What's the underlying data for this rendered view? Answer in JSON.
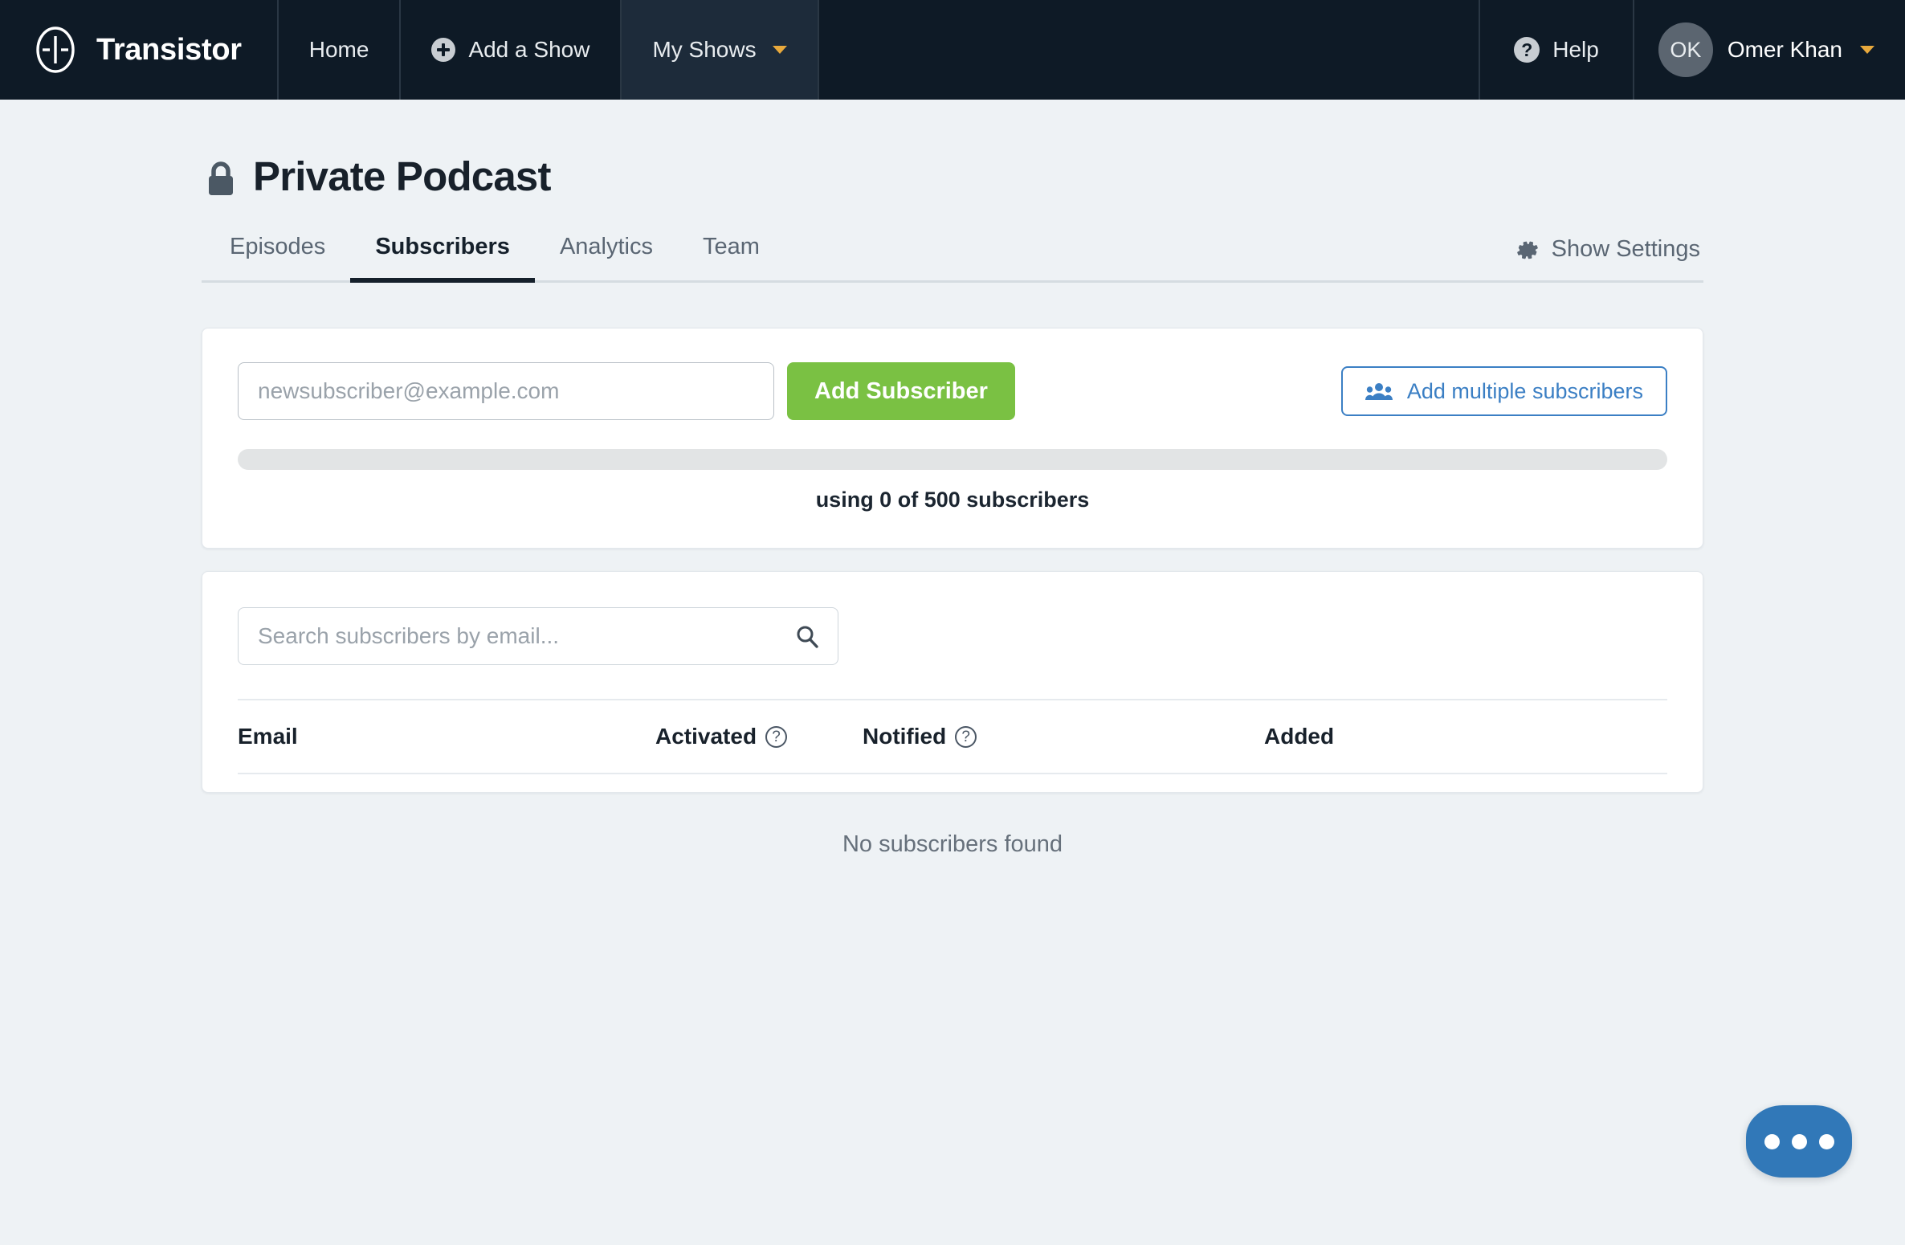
{
  "brand": {
    "name": "Transistor",
    "logo_icon": "transistor-logo-icon"
  },
  "nav": {
    "home_label": "Home",
    "add_show_label": "Add a Show",
    "add_show_icon": "plus-circle-icon",
    "my_shows_label": "My Shows",
    "my_shows_caret_icon": "chevron-down-icon",
    "help_label": "Help",
    "help_icon": "question-circle-icon",
    "user_initials": "OK",
    "user_name": "Omer Khan",
    "user_caret_icon": "chevron-down-icon"
  },
  "page": {
    "title": "Private Podcast",
    "lock_icon": "lock-icon"
  },
  "tabs": [
    {
      "label": "Episodes",
      "active": false
    },
    {
      "label": "Subscribers",
      "active": true
    },
    {
      "label": "Analytics",
      "active": false
    },
    {
      "label": "Team",
      "active": false
    }
  ],
  "show_settings": {
    "label": "Show Settings",
    "icon": "gear-icon"
  },
  "add_subscriber": {
    "email_placeholder": "newsubscriber@example.com",
    "email_value": "",
    "submit_label": "Add Subscriber",
    "multiple_label": "Add multiple subscribers",
    "multiple_icon": "users-icon",
    "usage_text": "using 0 of 500 subscribers",
    "used": 0,
    "limit": 500,
    "progress_percent": 0
  },
  "subscribers_table": {
    "search_placeholder": "Search subscribers by email...",
    "search_value": "",
    "search_icon": "search-icon",
    "columns": [
      {
        "label": "Email",
        "help": false
      },
      {
        "label": "Activated",
        "help": true
      },
      {
        "label": "Notified",
        "help": true
      },
      {
        "label": "Added",
        "help": false
      }
    ],
    "rows": [],
    "empty_message": "No subscribers found"
  },
  "chat_widget": {
    "icon": "chat-bubble-ellipsis-icon"
  },
  "colors": {
    "nav_bg": "#0e1a26",
    "nav_active_bg": "#1d2b3a",
    "page_bg": "#eef2f5",
    "accent_green": "#7ac143",
    "accent_blue": "#3b7fc4",
    "caret_amber": "#e8a93c",
    "chat_blue": "#3178b8",
    "text_dark": "#18212b",
    "text_muted": "#5a6673"
  }
}
